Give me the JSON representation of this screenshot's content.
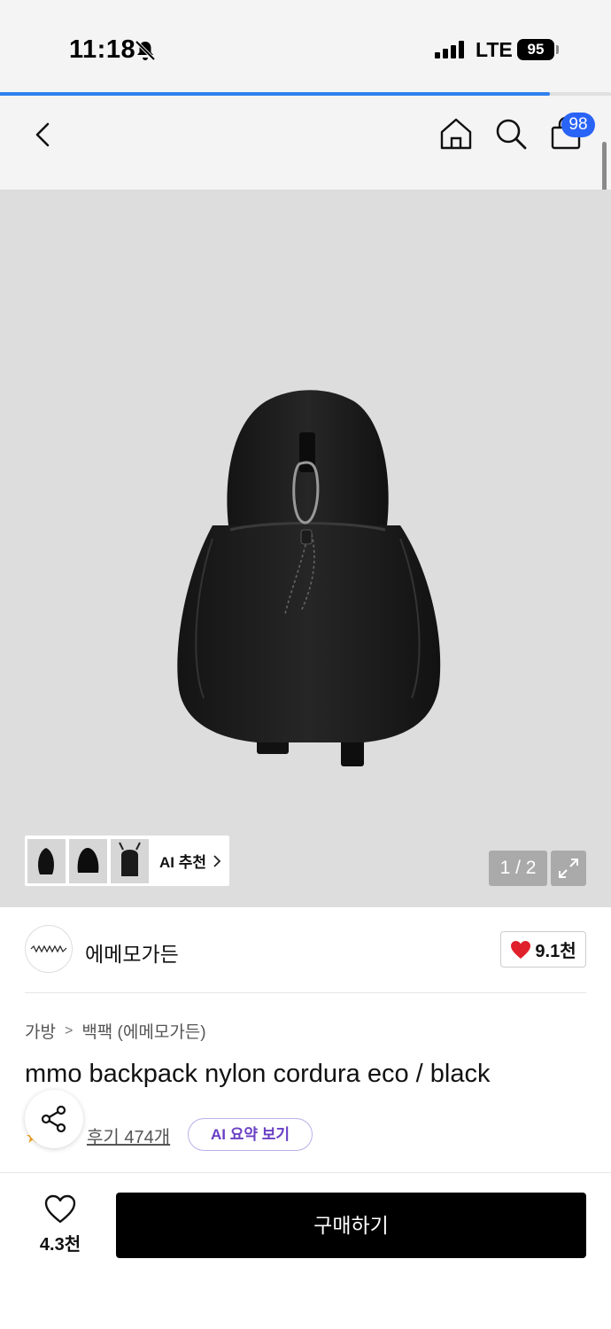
{
  "status_bar": {
    "time": "11:18",
    "network": "LTE",
    "battery": "95"
  },
  "page_load_progress": 0.9,
  "header": {
    "cart_count": "98"
  },
  "gallery": {
    "ai_recommend_label": "AI 추천",
    "pager": "1 / 2"
  },
  "brand": {
    "name": "에메모가든",
    "likes": "9.1천"
  },
  "breadcrumb": {
    "category": "가방",
    "subcategory": "백팩 (에메모가든)"
  },
  "product": {
    "title": "mmo backpack nylon cordura eco / black",
    "reviews": "후기 474개",
    "ai_summary": "AI 요약 보기"
  },
  "bottom_bar": {
    "wish_count": "4.3천",
    "buy_label": "구매하기"
  },
  "colors": {
    "accent_blue": "#2a64f6",
    "heart_red": "#e0202a",
    "ai_purple": "#6a3fc4"
  }
}
